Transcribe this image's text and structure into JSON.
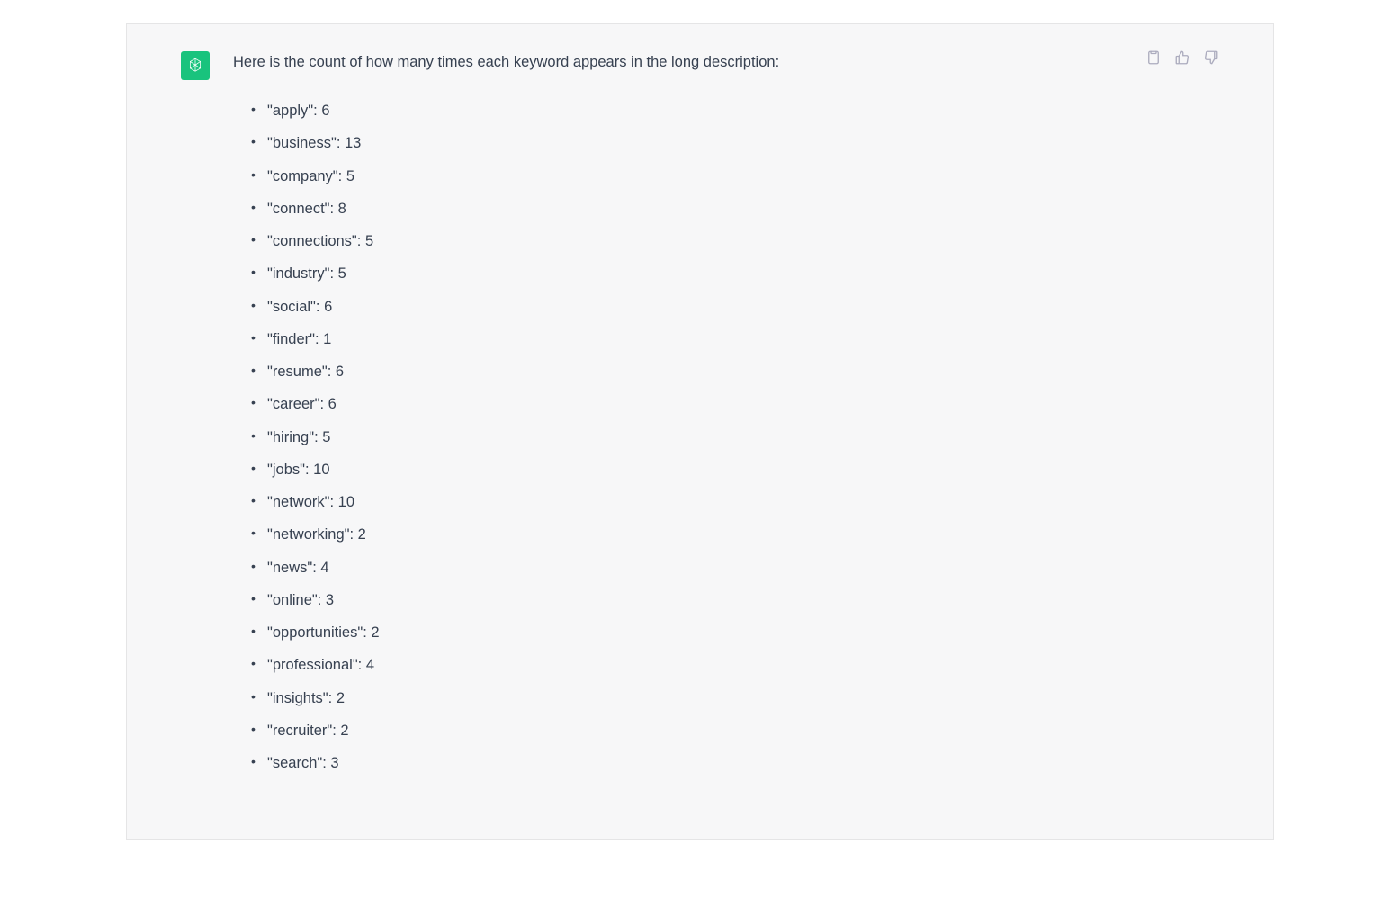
{
  "message": {
    "intro": "Here is the count of how many times each keyword appears in the long description:",
    "keywords": [
      {
        "term": "apply",
        "count": 6
      },
      {
        "term": "business",
        "count": 13
      },
      {
        "term": "company",
        "count": 5
      },
      {
        "term": "connect",
        "count": 8
      },
      {
        "term": "connections",
        "count": 5
      },
      {
        "term": "industry",
        "count": 5
      },
      {
        "term": "social",
        "count": 6
      },
      {
        "term": "finder",
        "count": 1
      },
      {
        "term": "resume",
        "count": 6
      },
      {
        "term": "career",
        "count": 6
      },
      {
        "term": "hiring",
        "count": 5
      },
      {
        "term": "jobs",
        "count": 10
      },
      {
        "term": "network",
        "count": 10
      },
      {
        "term": "networking",
        "count": 2
      },
      {
        "term": "news",
        "count": 4
      },
      {
        "term": "online",
        "count": 3
      },
      {
        "term": "opportunities",
        "count": 2
      },
      {
        "term": "professional",
        "count": 4
      },
      {
        "term": "insights",
        "count": 2
      },
      {
        "term": "recruiter",
        "count": 2
      },
      {
        "term": "search",
        "count": 3
      }
    ]
  }
}
